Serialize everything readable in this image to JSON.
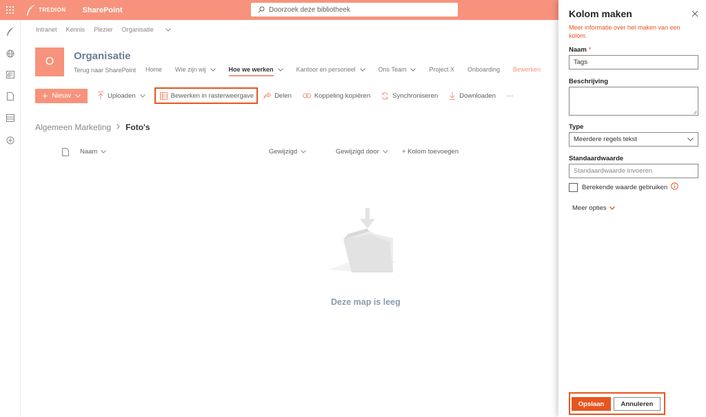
{
  "suite": {
    "brand": "TREDION",
    "app_name": "SharePoint",
    "search_placeholder": "Doorzoek deze bibliotheek"
  },
  "hub_nav": [
    "Intranet",
    "Kennis",
    "Plezier",
    "Organisatie"
  ],
  "site": {
    "logo_letter": "O",
    "title": "Organisatie",
    "back_link": "Terug naar SharePoint",
    "nav": [
      {
        "label": "Home"
      },
      {
        "label": "Wie zijn wij"
      },
      {
        "label": "Hoe we werken"
      },
      {
        "label": "Kantoor en personeel"
      },
      {
        "label": "Ons Team"
      },
      {
        "label": "Project X"
      },
      {
        "label": "Onboarding"
      },
      {
        "label": "Bewerken"
      }
    ]
  },
  "command_bar": {
    "new": "Nieuw",
    "upload": "Uploaden",
    "grid_edit": "Bewerken in rasterweergave",
    "share": "Delen",
    "copy_link": "Koppeling kopiëren",
    "sync": "Synchroniseren",
    "download": "Downloaden",
    "more": "···"
  },
  "breadcrumb": {
    "parent": "Algemeen Marketing",
    "current": "Foto's"
  },
  "list_columns": {
    "name": "Naam",
    "modified": "Gewijzigd",
    "modified_by": "Gewijzigd door",
    "add_column": "+ Kolom toevoegen"
  },
  "empty_state": "Deze map is leeg",
  "panel": {
    "title": "Kolom maken",
    "info_link": "Meer informatie over het maken van een kolom.",
    "name_label": "Naam",
    "required_mark": "*",
    "name_value": "Tags",
    "description_label": "Beschrijving",
    "type_label": "Type",
    "type_value": "Meerdere regels tekst",
    "default_label": "Standaardwaarde",
    "default_placeholder": "Standaardwaarde invoeren",
    "calculated_label": "Berekende waarde gebruiken",
    "more_options": "Meer opties",
    "save": "Opslaan",
    "cancel": "Annuleren"
  },
  "colors": {
    "accent": "#f7937c",
    "accent_dark": "#e8551f"
  }
}
